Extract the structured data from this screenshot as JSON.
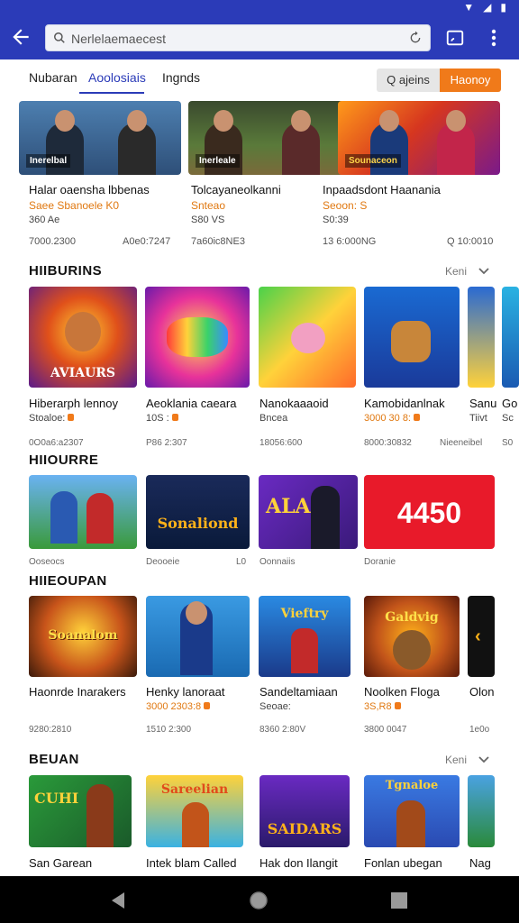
{
  "colors": {
    "appbar": "#2b3bb8",
    "accent": "#f07a1a",
    "active_tab": "#2b3bb8"
  },
  "toolbar": {
    "search_text": "Nerlelaemaecest",
    "icons": [
      "back-arrow-icon",
      "search-icon",
      "refresh-icon",
      "cast-icon",
      "more-vert-icon"
    ]
  },
  "tabs": [
    {
      "label": "Nubaran"
    },
    {
      "label": "Aoolosiais"
    },
    {
      "label": "Ingnds"
    }
  ],
  "segment": {
    "left_label": "Q ajeins",
    "right_label": "Haonoy"
  },
  "featured": [
    {
      "title": "Halar oaensha lbbenas",
      "subtitle": "Saee Sbanoele K0",
      "price": "360 Ae",
      "meta_left": "7000.2300",
      "meta_right": "A0e0:7247",
      "art_label": "Inerelbal"
    },
    {
      "title": "Tolcayaneolkanni",
      "subtitle": "Snteao",
      "price": "S80 VS",
      "meta_left": "7a60ic8NE3",
      "meta_right": "",
      "art_label": "Inerleale"
    },
    {
      "title": "Inpaadsdont Haanania",
      "subtitle": "Seoon: S",
      "price": "S0:39",
      "meta_left": "13 6:000NG",
      "meta_right": "Q 10:0010",
      "art_label": "Sounaceon"
    }
  ],
  "sections": [
    {
      "title": "HIIBURINS",
      "more_label": "Keni",
      "cards": [
        {
          "title": "Hiberarph lennoy",
          "subtitle": "Stoaloe:",
          "meta": "0O0a6:a2307",
          "art": "AVIAURS"
        },
        {
          "title": "Aeoklania caeara",
          "subtitle": "10S :",
          "meta": "P86 2:307",
          "art": ""
        },
        {
          "title": "Nanokaaaoid",
          "subtitle": "Bncea",
          "meta": "18056:600",
          "art": ""
        },
        {
          "title": "Kamobidanlnak",
          "subtitle": "3000 30 8:",
          "meta": "8000:30832",
          "art": ""
        },
        {
          "title": "Sanu",
          "subtitle": "Tiivt",
          "meta": "Nieeneibel",
          "art": ""
        },
        {
          "title": "Go",
          "subtitle": "Sc",
          "meta": "S0",
          "art": ""
        }
      ]
    },
    {
      "title": "HIIOURRE",
      "more_label": "",
      "cards": [
        {
          "title": "",
          "subtitle": "Ooseocs",
          "meta": "",
          "art": ""
        },
        {
          "title": "",
          "subtitle": "Deooeie",
          "meta": "L0",
          "art": "Sonaliond"
        },
        {
          "title": "",
          "subtitle": "Oonnaiis",
          "meta": "",
          "art": "ALAS"
        },
        {
          "title": "",
          "subtitle": "Doranie",
          "meta": "",
          "art": "4450"
        }
      ]
    },
    {
      "title": "HIIEOUPAN",
      "more_label": "",
      "cards": [
        {
          "title": "Haonrde Inarakers",
          "subtitle": "",
          "meta": "9280:2810",
          "art": "Soanalom"
        },
        {
          "title": "Henky lanoraat",
          "subtitle": "3000 2303:8",
          "meta": "1510 2:300",
          "art": ""
        },
        {
          "title": "Sandeltamiaan",
          "subtitle": "Seoae:",
          "meta": "8360 2:80V",
          "art": "Vieftry"
        },
        {
          "title": "Noolken Floga",
          "subtitle": "3S,R8",
          "meta": "3800 0047",
          "art": "Galdvig"
        },
        {
          "title": "Olon",
          "subtitle": "",
          "meta": "1e0o",
          "art": ""
        }
      ]
    },
    {
      "title": "BEUAN",
      "more_label": "Keni",
      "cards": [
        {
          "title": "San Garean",
          "subtitle": "",
          "meta": "",
          "art": "CUHI"
        },
        {
          "title": "Intek blam Called",
          "subtitle": "",
          "meta": "",
          "art": "Sareelian"
        },
        {
          "title": "Hak don Ilangit",
          "subtitle": "",
          "meta": "",
          "art": "SAIDARS"
        },
        {
          "title": "Fonlan ubegan",
          "subtitle": "",
          "meta": "",
          "art": "Tgnaloe"
        },
        {
          "title": "Nag",
          "subtitle": "",
          "meta": "",
          "art": ""
        }
      ]
    }
  ],
  "navbar": {
    "icons": [
      "nav-back-icon",
      "nav-home-icon",
      "nav-recents-icon"
    ]
  }
}
